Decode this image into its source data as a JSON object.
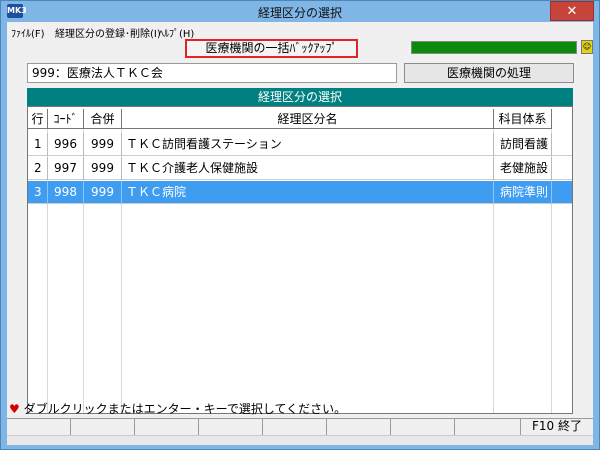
{
  "window": {
    "title": "経理区分の選択",
    "icon_label": "MK3",
    "close_glyph": "✕"
  },
  "menu": [
    {
      "label": "ﾌｧｲﾙ(F)"
    },
    {
      "label": "経理区分の登録･削除(I)"
    },
    {
      "label": "ﾍﾙﾌﾟ(H)"
    }
  ],
  "toolbar": {
    "backup_label": "医療機関の一括ﾊﾞｯｸｱｯﾌﾟ",
    "progress_fraction": 1.0,
    "lamp_glyph": "☺"
  },
  "org": {
    "value": "999：医療法人ＴＫＣ会",
    "process_button": "医療機関の処理"
  },
  "section": {
    "title": "経理区分の選択"
  },
  "table": {
    "columns": [
      "行",
      "ｺｰﾄﾞ",
      "合併",
      "経理区分名",
      "科目体系"
    ],
    "rows": [
      {
        "row": "1",
        "code": "996",
        "merge": "999",
        "name": "ＴＫＣ訪問看護ステーション",
        "system": "訪問看護",
        "selected": false
      },
      {
        "row": "2",
        "code": "997",
        "merge": "999",
        "name": "ＴＫＣ介護老人保健施設",
        "system": "老健施設",
        "selected": false
      },
      {
        "row": "3",
        "code": "998",
        "merge": "999",
        "name": "ＴＫＣ病院",
        "system": "病院準則",
        "selected": true
      }
    ]
  },
  "status": {
    "message": "ダブルクリックまたはエンター・キーで選択してください。"
  },
  "fkeys": {
    "f10_label": "F10 終了"
  }
}
